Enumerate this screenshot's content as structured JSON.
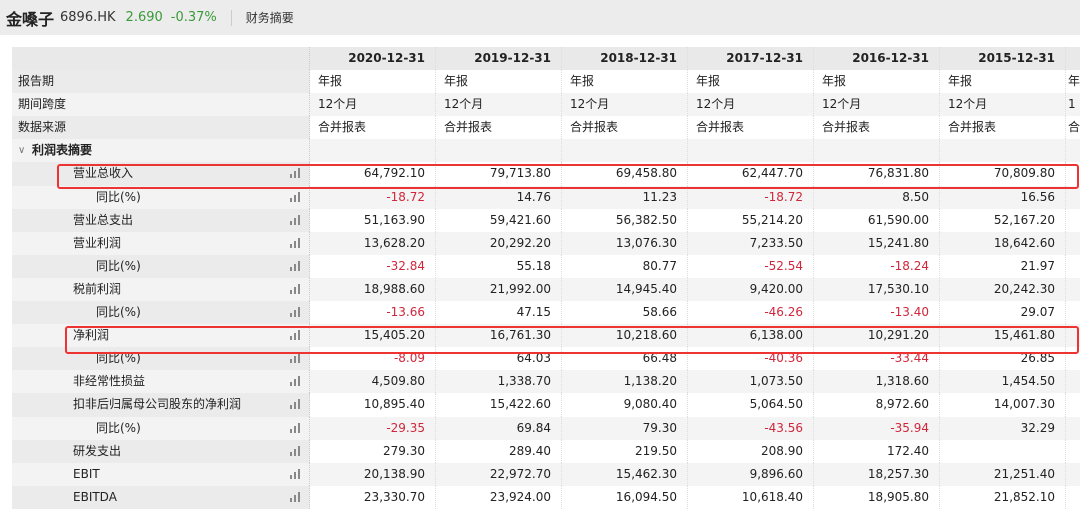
{
  "header": {
    "name": "金嗓子",
    "code": "6896.HK",
    "price": "2.690",
    "change": "-0.37%",
    "tab": "财务摘要"
  },
  "columns": [
    "2020-12-31",
    "2019-12-31",
    "2018-12-31",
    "2017-12-31",
    "2016-12-31",
    "2015-12-31"
  ],
  "meta_rows": [
    {
      "label": "报告期",
      "values": [
        "年报",
        "年报",
        "年报",
        "年报",
        "年报",
        "年报",
        "年"
      ]
    },
    {
      "label": "期间跨度",
      "values": [
        "12个月",
        "12个月",
        "12个月",
        "12个月",
        "12个月",
        "12个月",
        "1"
      ]
    },
    {
      "label": "数据来源",
      "values": [
        "合并报表",
        "合并报表",
        "合并报表",
        "合并报表",
        "合并报表",
        "合并报表",
        "合"
      ]
    }
  ],
  "section": "利润表摘要",
  "rows": [
    {
      "label": "营业总收入",
      "level": 1,
      "values": [
        "64,792.10",
        "79,713.80",
        "69,458.80",
        "62,447.70",
        "76,831.80",
        "70,809.80"
      ],
      "highlight": true
    },
    {
      "label": "同比(%)",
      "level": 2,
      "values": [
        "-18.72",
        "14.76",
        "11.23",
        "-18.72",
        "8.50",
        "16.56"
      ]
    },
    {
      "label": "营业总支出",
      "level": 1,
      "values": [
        "51,163.90",
        "59,421.60",
        "56,382.50",
        "55,214.20",
        "61,590.00",
        "52,167.20"
      ]
    },
    {
      "label": "营业利润",
      "level": 1,
      "values": [
        "13,628.20",
        "20,292.20",
        "13,076.30",
        "7,233.50",
        "15,241.80",
        "18,642.60"
      ]
    },
    {
      "label": "同比(%)",
      "level": 2,
      "values": [
        "-32.84",
        "55.18",
        "80.77",
        "-52.54",
        "-18.24",
        "21.97"
      ]
    },
    {
      "label": "税前利润",
      "level": 1,
      "values": [
        "18,988.60",
        "21,992.00",
        "14,945.40",
        "9,420.00",
        "17,530.10",
        "20,242.30"
      ]
    },
    {
      "label": "同比(%)",
      "level": 2,
      "values": [
        "-13.66",
        "47.15",
        "58.66",
        "-46.26",
        "-13.40",
        "29.07"
      ]
    },
    {
      "label": "净利润",
      "level": 1,
      "values": [
        "15,405.20",
        "16,761.30",
        "10,218.60",
        "6,138.00",
        "10,291.20",
        "15,461.80"
      ],
      "highlight": true
    },
    {
      "label": "同比(%)",
      "level": 2,
      "values": [
        "-8.09",
        "64.03",
        "66.48",
        "-40.36",
        "-33.44",
        "26.85"
      ]
    },
    {
      "label": "非经常性损益",
      "level": 1,
      "values": [
        "4,509.80",
        "1,338.70",
        "1,138.20",
        "1,073.50",
        "1,318.60",
        "1,454.50"
      ]
    },
    {
      "label": "扣非后归属母公司股东的净利润",
      "level": 1,
      "values": [
        "10,895.40",
        "15,422.60",
        "9,080.40",
        "5,064.50",
        "8,972.60",
        "14,007.30"
      ]
    },
    {
      "label": "同比(%)",
      "level": 2,
      "values": [
        "-29.35",
        "69.84",
        "79.30",
        "-43.56",
        "-35.94",
        "32.29"
      ]
    },
    {
      "label": "研发支出",
      "level": 1,
      "values": [
        "279.30",
        "289.40",
        "219.50",
        "208.90",
        "172.40",
        ""
      ]
    },
    {
      "label": "EBIT",
      "level": 1,
      "values": [
        "20,138.90",
        "22,972.70",
        "15,462.30",
        "9,896.60",
        "18,257.30",
        "21,251.40"
      ]
    },
    {
      "label": "EBITDA",
      "level": 1,
      "values": [
        "23,330.70",
        "23,924.00",
        "16,094.50",
        "10,618.40",
        "18,905.80",
        "21,852.10"
      ]
    }
  ],
  "colors": {
    "negative": "#d0263b",
    "positive": "#3a9a3a",
    "highlight_box": "#ee3333"
  }
}
